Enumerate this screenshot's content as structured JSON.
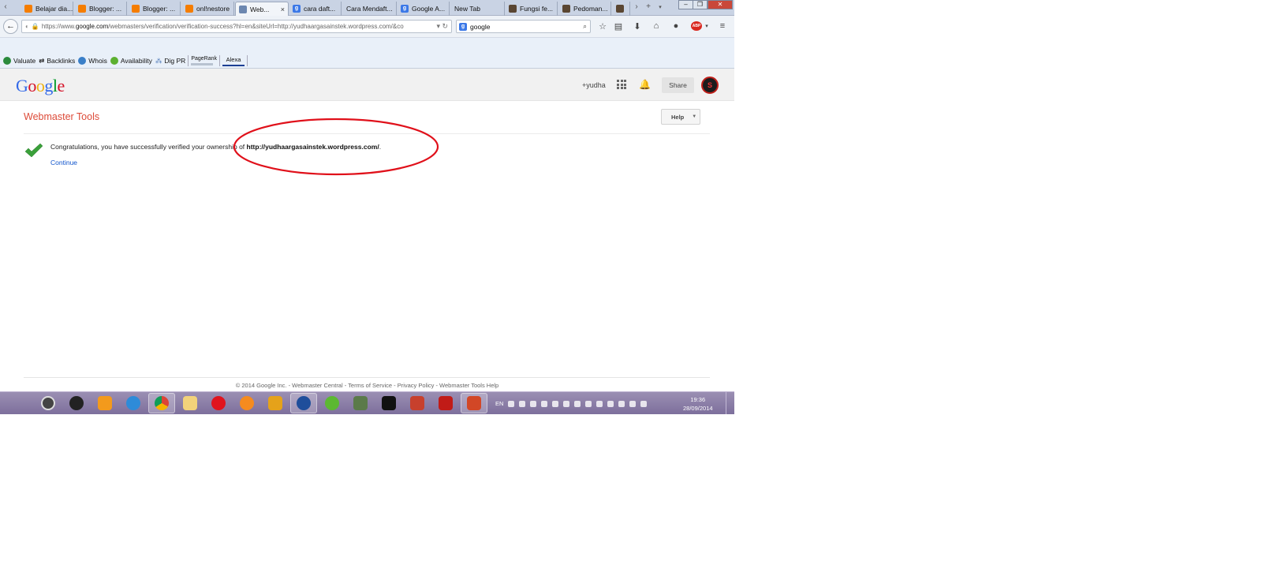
{
  "browser": {
    "tabs": [
      {
        "label": "Belajar dia...",
        "icon": "blogger-icon"
      },
      {
        "label": "Blogger: ...",
        "icon": "blogger-icon"
      },
      {
        "label": "Blogger: ...",
        "icon": "blogger-icon"
      },
      {
        "label": "onl!nestore",
        "icon": "blogger-icon"
      },
      {
        "label": "Web...",
        "icon": "webmaster-icon",
        "active": true,
        "close": "×"
      },
      {
        "label": "cara daft...",
        "icon": "google-icon"
      },
      {
        "label": "Cara Mendaft...",
        "icon": ""
      },
      {
        "label": "Google A...",
        "icon": "google-icon"
      },
      {
        "label": "New Tab",
        "icon": ""
      },
      {
        "label": "Fungsi fe...",
        "icon": "person-icon"
      },
      {
        "label": "Pedoman...",
        "icon": "person-icon"
      },
      {
        "label": "",
        "icon": "person-icon"
      }
    ],
    "url_prefix": "https://www.",
    "url_domain": "google.com",
    "url_rest": "/webmasters/verification/verification-success?hl=en&siteUrl=http://yudhaargasainstek.wordpress.com/&co",
    "search_value": "google",
    "abp_label": "ABP"
  },
  "toolbar": {
    "items": [
      "Valuate",
      "Backlinks",
      "Whois",
      "Availability",
      "Dig PR"
    ],
    "pagerank_label": "PageRank",
    "alexa_label": "Alexa"
  },
  "google_header": {
    "logo": "Google",
    "user": "+yudha",
    "share_label": "Share"
  },
  "main": {
    "title": "Webmaster Tools",
    "help_label": "Help",
    "message_text": "Congratulations, you have successfully verified your ownership of ",
    "site_url": "http://yudhaargasainstek.wordpress.com/",
    "message_end": ".",
    "continue_label": "Continue"
  },
  "footer": {
    "text": "© 2014 Google Inc. - Webmaster Central - Terms of Service - Privacy Policy - Webmaster Tools Help"
  },
  "taskbar": {
    "lang": "EN",
    "time": "19:36",
    "date": "28/09/2014"
  },
  "colors": {
    "google_red": "#dd4b39",
    "link_blue": "#1155cc",
    "annotation_red": "#e0101a",
    "check_green": "#3aa03a"
  }
}
